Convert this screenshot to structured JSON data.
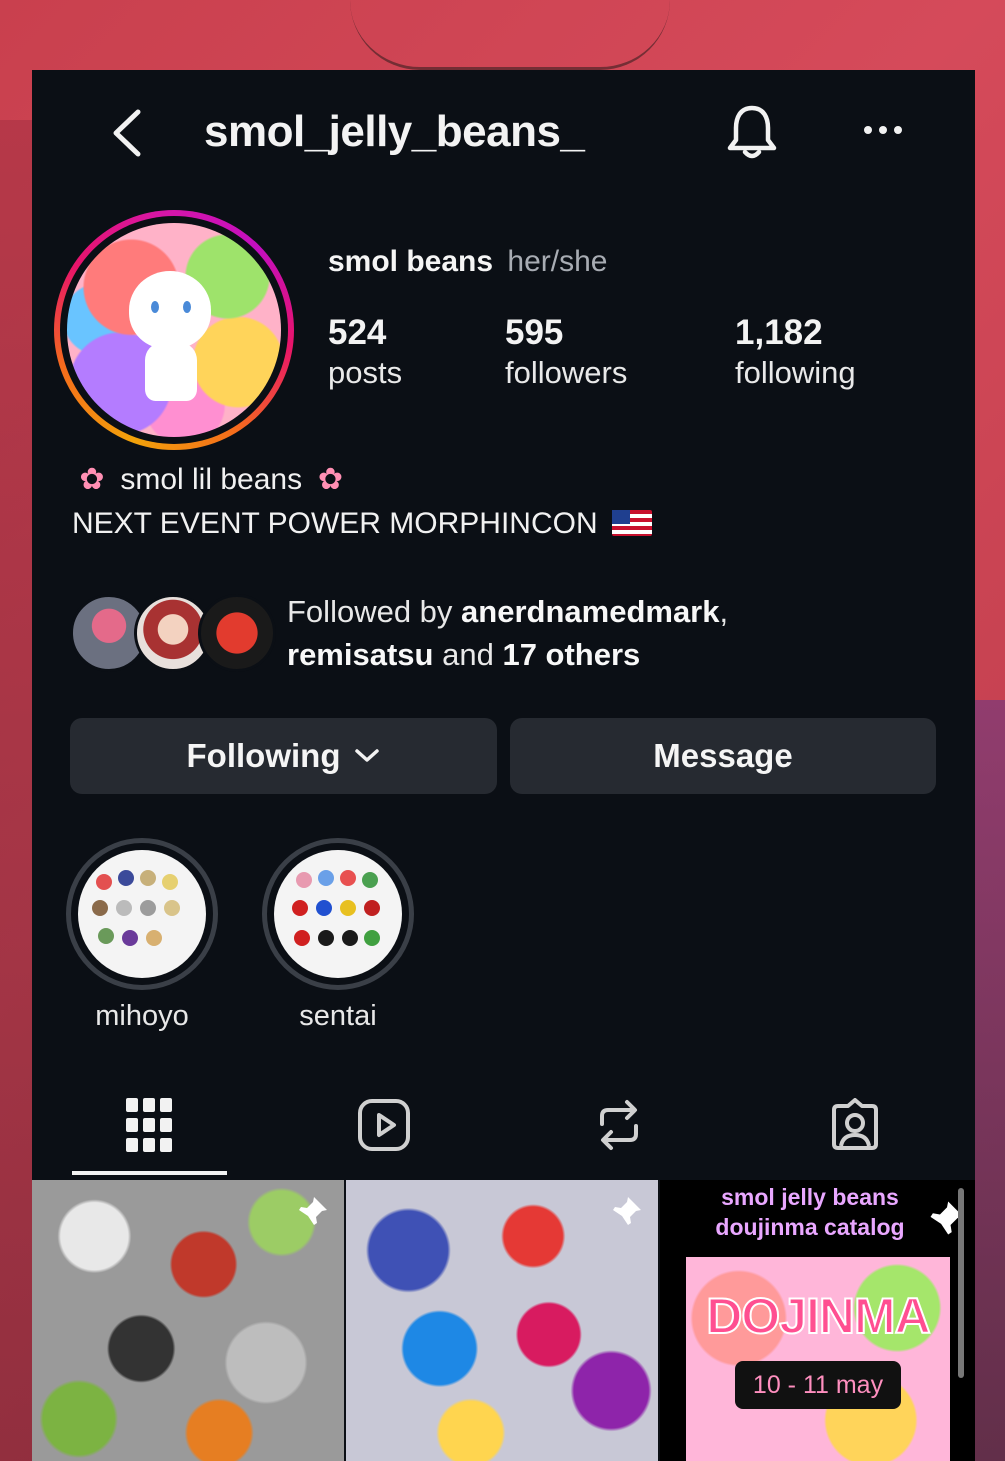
{
  "header": {
    "username": "smol_jelly_beans_",
    "back_icon": "chevron-left-icon",
    "bell_icon": "bell-icon",
    "more_icon": "more-horizontal-icon"
  },
  "profile": {
    "display_name": "smol beans",
    "pronouns": "her/she",
    "stats": [
      {
        "value": "524",
        "label": "posts"
      },
      {
        "value": "595",
        "label": "followers"
      },
      {
        "value": "1,182",
        "label": "following"
      }
    ],
    "bio_line1": "smol lil beans",
    "bio_line2": "NEXT EVENT POWER MORPHINCON"
  },
  "followed_by": {
    "prefix": "Followed by",
    "name1": "anerdnamedmark",
    "name2": "remisatsu",
    "and_text": "and",
    "others": "17 others"
  },
  "actions": {
    "following_label": "Following",
    "message_label": "Message"
  },
  "highlights": [
    {
      "label": "mihoyo"
    },
    {
      "label": "sentai"
    }
  ],
  "tabs": [
    "grid-icon",
    "reels-icon",
    "reposts-icon",
    "tagged-icon"
  ],
  "posts": {
    "pinned_tile_title_line1": "smol jelly beans",
    "pinned_tile_title_line2": "doujinma catalog",
    "poster_title": "DOJINMA",
    "poster_date": "10 - 11 may"
  },
  "colors": {
    "background": "#0b0f15",
    "button": "#262a31",
    "secondary_text": "#a8acb3"
  }
}
